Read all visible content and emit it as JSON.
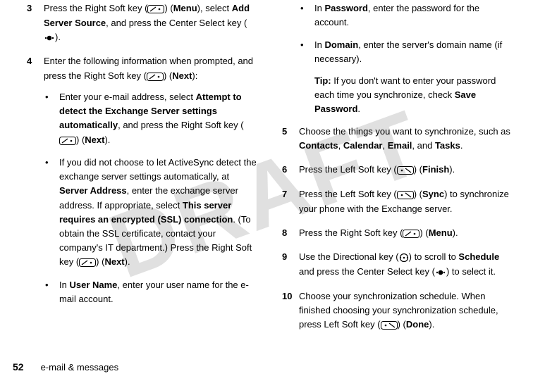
{
  "watermark": "DRAFT",
  "left": {
    "step3_num": "3",
    "step3_text_a": "Press the Right Soft key (",
    "step3_text_b": ") (",
    "step3_menu": "Menu",
    "step3_text_c": "), select ",
    "step3_add": "Add Server Source",
    "step3_text_d": ", and press the Center Select key (",
    "step3_text_e": ").",
    "step4_num": "4",
    "step4_text_a": "Enter the following information when prompted, and press the Right Soft key (",
    "step4_text_b": ") (",
    "step4_next": "Next",
    "step4_text_c": "):",
    "b1_a": "Enter your e-mail address, select ",
    "b1_bold": "Attempt to detect the Exchange Server settings automatically",
    "b1_b": ", and press the Right Soft key (",
    "b1_c": ") (",
    "b1_next": "Next",
    "b1_d": ").",
    "b2_a": "If you did not choose to let ActiveSync detect the exchange server settings automatically, at ",
    "b2_server": "Server Address",
    "b2_b": ", enter the exchange server address. If appropriate, select ",
    "b2_ssl": "This server requires an encrypted (SSL) connection",
    "b2_c": ". (To obtain the SSL certificate, contact your company's IT department.) Press the Right Soft key (",
    "b2_d": ") (",
    "b2_next": "Next",
    "b2_e": ").",
    "b3_a": "In ",
    "b3_user": "User Name",
    "b3_b": ", enter your user name for the e-mail account."
  },
  "right": {
    "b4_a": "In ",
    "b4_pw": "Password",
    "b4_b": ", enter the password for the account.",
    "b5_a": "In ",
    "b5_dom": "Domain",
    "b5_b": ", enter the server's domain name (if necessary).",
    "tip_label": "Tip:",
    "tip_text_a": " If you don't want to enter your password each time you synchronize, check ",
    "tip_save": "Save Password",
    "tip_text_b": ".",
    "step5_num": "5",
    "step5_a": "Choose the things you want to synchronize, such as ",
    "step5_contacts": "Contacts",
    "step5_sep1": ", ",
    "step5_calendar": "Calendar",
    "step5_sep2": ", ",
    "step5_email": "Email",
    "step5_sep3": ", and ",
    "step5_tasks": "Tasks",
    "step5_end": ".",
    "step6_num": "6",
    "step6_a": "Press the Left Soft key (",
    "step6_b": ") (",
    "step6_finish": "Finish",
    "step6_c": ").",
    "step7_num": "7",
    "step7_a": "Press the Left Soft key (",
    "step7_b": ") (",
    "step7_sync": "Sync",
    "step7_c": ") to synchronize your phone with the Exchange server.",
    "step8_num": "8",
    "step8_a": "Press the Right Soft key (",
    "step8_b": ") (",
    "step8_menu": "Menu",
    "step8_c": ").",
    "step9_num": "9",
    "step9_a": "Use the Directional key (",
    "step9_b": ") to scroll to ",
    "step9_sched": "Schedule",
    "step9_c": " and press the Center Select key (",
    "step9_d": ") to select it.",
    "step10_num": "10",
    "step10_a": "Choose your synchronization schedule. When finished choosing your synchronization schedule, press Left Soft key (",
    "step10_b": ") (",
    "step10_done": "Done",
    "step10_c": ")."
  },
  "footer": {
    "page": "52",
    "section": "e-mail & messages"
  }
}
